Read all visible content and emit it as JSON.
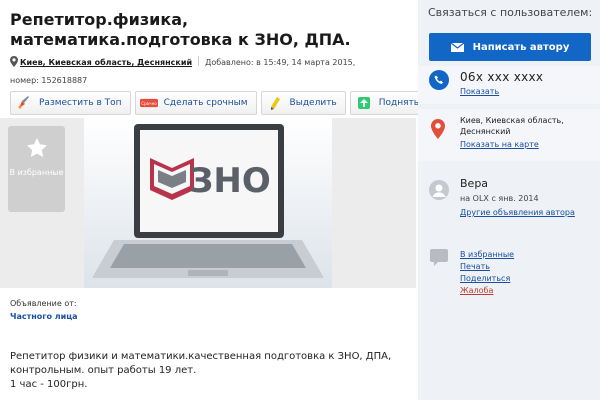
{
  "ad": {
    "title": "Репетитор.физика, математика.подготовка к ЗНО, ДПА.",
    "location": "Киев, Киевская область, Деснянский",
    "added": "Добавлено: в 15:49, 14 марта 2015,",
    "number": "номер: 152618887"
  },
  "toolbar": {
    "top_label": "Разместить в Топ",
    "urgent_badge": "Срочно",
    "urgent_label": "Сделать срочным",
    "highlight_label": "Выделить",
    "raise_label": "Поднять"
  },
  "gallery": {
    "favorite_label": "В избранные",
    "photo_text": "ЗНО"
  },
  "seller": {
    "label": "Объявление от:",
    "type": "Частного лица"
  },
  "description": {
    "line1": "Репетитор физики и математики.качественная подготовка к ЗНО, ДПА,",
    "line2": "контрольным. опыт работы 19 лет.",
    "line3": "1 час - 100грн."
  },
  "contact": {
    "heading": "Связаться с пользователем:",
    "write_button": "Написать автору",
    "phone": "06x xxx xxxx",
    "show_phone": "Показать",
    "location": "Киев, Киевская область, Деснянский",
    "show_map": "Показать на карте"
  },
  "user": {
    "name": "Вера",
    "since": "на OLX с янв. 2014",
    "other_ads": "Другие объявления автора"
  },
  "actions": {
    "favorites": "В избранные",
    "print": "Печать",
    "share": "Поделиться",
    "report": "Жалоба"
  },
  "colors": {
    "accent": "#1266c5",
    "link": "#1a4fa0",
    "report": "#c0392b",
    "sidebar_bg": "#eef1f5"
  },
  "icons": [
    "map-pin-icon",
    "rocket-icon",
    "urgent-badge-icon",
    "highlighter-icon",
    "raise-icon",
    "star-icon",
    "envelope-icon",
    "phone-icon",
    "location-pin-icon",
    "user-icon",
    "speech-bubble-icon"
  ]
}
